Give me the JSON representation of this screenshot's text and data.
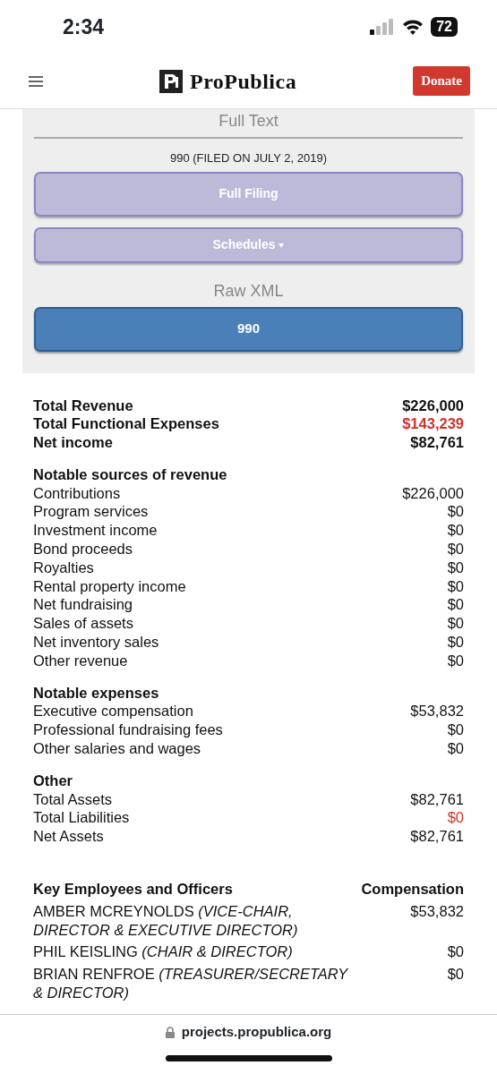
{
  "status_bar": {
    "time": "2:34",
    "battery": "72"
  },
  "header": {
    "logo": "ProPublica",
    "donate": "Donate"
  },
  "filing_panel": {
    "full_text_heading": "Full Text",
    "filing_label": "990 (FILED ON JULY 2, 2019)",
    "buttons": [
      {
        "label": "Full Filing",
        "kind": "pdf"
      },
      {
        "label": "Schedules",
        "kind": "dropdown"
      }
    ],
    "raw_heading": "Raw XML",
    "raw_button": "990"
  },
  "summary": [
    {
      "label": "Total Revenue",
      "value": "$226,000",
      "alert": false
    },
    {
      "label": "Total Functional Expenses",
      "value": "$143,239",
      "alert": true
    },
    {
      "label": "Net income",
      "value": "$82,761",
      "alert": false
    }
  ],
  "sections": [
    {
      "title": "Notable sources of revenue",
      "rows": [
        {
          "label": "Contributions",
          "value": "$226,000",
          "alert": false
        },
        {
          "label": "Program services",
          "value": "$0",
          "alert": false
        },
        {
          "label": "Investment income",
          "value": "$0",
          "alert": false
        },
        {
          "label": "Bond proceeds",
          "value": "$0",
          "alert": false
        },
        {
          "label": "Royalties",
          "value": "$0",
          "alert": false
        },
        {
          "label": "Rental property income",
          "value": "$0",
          "alert": false
        },
        {
          "label": "Net fundraising",
          "value": "$0",
          "alert": false
        },
        {
          "label": "Sales of assets",
          "value": "$0",
          "alert": false
        },
        {
          "label": "Net inventory sales",
          "value": "$0",
          "alert": false
        },
        {
          "label": "Other revenue",
          "value": "$0",
          "alert": false
        }
      ]
    },
    {
      "title": "Notable expenses",
      "rows": [
        {
          "label": "Executive compensation",
          "value": "$53,832",
          "alert": false
        },
        {
          "label": "Professional fundraising fees",
          "value": "$0",
          "alert": false
        },
        {
          "label": "Other salaries and wages",
          "value": "$0",
          "alert": false
        }
      ]
    },
    {
      "title": "Other",
      "rows": [
        {
          "label": "Total Assets",
          "value": "$82,761",
          "alert": false
        },
        {
          "label": "Total Liabilities",
          "value": "$0",
          "alert": true
        },
        {
          "label": "Net Assets",
          "value": "$82,761",
          "alert": false
        }
      ]
    }
  ],
  "employees": {
    "columns": [
      "Key Employees and Officers",
      "Compensation"
    ],
    "rows": [
      {
        "name": "AMBER MCREYNOLDS *(VICE-CHAIR, DIRECTOR & EXECUTIVE DIRECTOR)*",
        "compensation": "$53,832"
      },
      {
        "name": "PHIL KEISLING *(CHAIR & DIRECTOR)*",
        "compensation": "$0"
      },
      {
        "name": "BRIAN RENFROE *(TREASURER/SECRETARY & DIRECTOR)*",
        "compensation": "$0"
      }
    ]
  },
  "address_bar": {
    "url": "projects.propublica.org"
  }
}
